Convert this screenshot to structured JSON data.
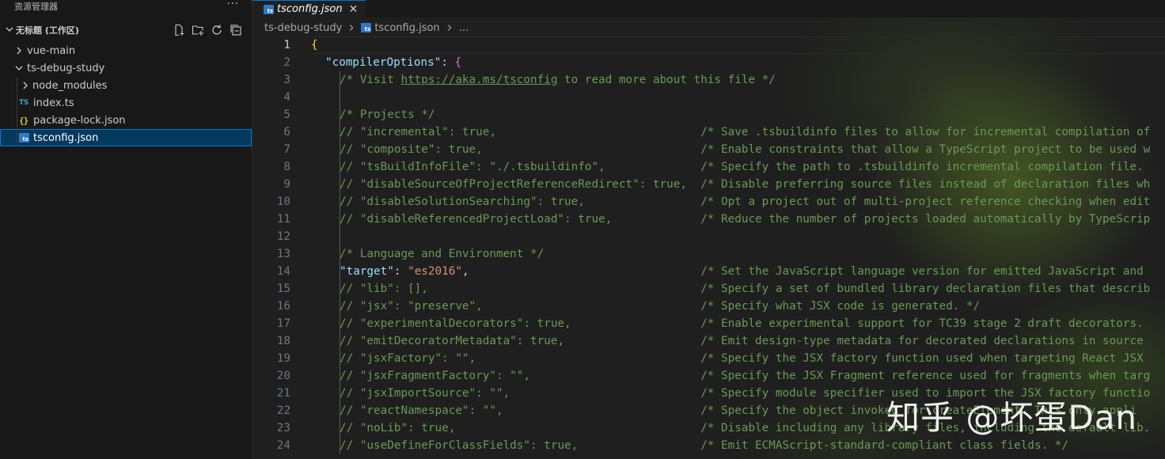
{
  "sidebar": {
    "title": "资源管理器",
    "more": "···",
    "workspace": "无标题 (工作区)",
    "items": [
      {
        "label": "vue-main"
      },
      {
        "label": "ts-debug-study"
      },
      {
        "label": "node_modules"
      },
      {
        "label": "index.ts",
        "badge": "TS"
      },
      {
        "label": "package-lock.json",
        "badge": "{}"
      },
      {
        "label": "tsconfig.json",
        "badge": "ts"
      }
    ]
  },
  "tab": {
    "label": "tsconfig.json",
    "close": "✕",
    "badge": "ts"
  },
  "breadcrumb": {
    "folder": "ts-debug-study",
    "file": "tsconfig.json",
    "rest": "..."
  },
  "code": {
    "ln": [
      "1",
      "2",
      "3",
      "4",
      "5",
      "6",
      "7",
      "8",
      "9",
      "10",
      "11",
      "12",
      "13",
      "14",
      "15",
      "16",
      "17",
      "18",
      "19",
      "20",
      "21",
      "22",
      "23",
      "24"
    ],
    "l1": "{",
    "l2_key": "\"compilerOptions\"",
    "l2_punct": ": ",
    "l2_brace": "{",
    "l3_a": "/* Visit ",
    "l3_link": "https://aka.ms/tsconfig",
    "l3_b": " to read more about this file */",
    "l5": "/* Projects */",
    "l6": "// \"incremental\": true,                              /* Save .tsbuildinfo files to allow for incremental compilation of",
    "l7": "// \"composite\": true,                                /* Enable constraints that allow a TypeScript project to be used w",
    "l8": "// \"tsBuildInfoFile\": \"./.tsbuildinfo\",              /* Specify the path to .tsbuildinfo incremental compilation file.",
    "l9": "// \"disableSourceOfProjectReferenceRedirect\": true,  /* Disable preferring source files instead of declaration files wh",
    "l10": "// \"disableSolutionSearching\": true,                 /* Opt a project out of multi-project reference checking when edit",
    "l11": "// \"disableReferencedProjectLoad\": true,             /* Reduce the number of projects loaded automatically by TypeScrip",
    "l13": "/* Language and Environment */",
    "l14_key": "\"target\"",
    "l14_punct": ": ",
    "l14_val": "\"es2016\"",
    "l14_comma": ",",
    "l14_com": "                                  /* Set the JavaScript language version for emitted JavaScript and",
    "l15": "// \"lib\": [],                                        /* Specify a set of bundled library declaration files that describ",
    "l16": "// \"jsx\": \"preserve\",                                /* Specify what JSX code is generated. */",
    "l17": "// \"experimentalDecorators\": true,                   /* Enable experimental support for TC39 stage 2 draft decorators.",
    "l18": "// \"emitDecoratorMetadata\": true,                    /* Emit design-type metadata for decorated declarations in source",
    "l19": "// \"jsxFactory\": \"\",                                 /* Specify the JSX factory function used when targeting React JSX",
    "l20": "// \"jsxFragmentFactory\": \"\",                         /* Specify the JSX Fragment reference used for fragments when targ",
    "l21": "// \"jsxImportSource\": \"\",                            /* Specify module specifier used to import the JSX factory functio",
    "l22": "// \"reactNamespace\": \"\",                             /* Specify the object invoked for createElement. This only appli",
    "l23": "// \"noLib\": true,                                    /* Disable including any library files, including the default lib.",
    "l24": "// \"useDefineForClassFields\": true,                  /* Emit ECMAScript-standard-compliant class fields. */"
  },
  "watermark": "知乎 @坏蛋Dan",
  "colors": {
    "accent": "#0078d4",
    "comment": "#6a9955",
    "key": "#9cdcfe",
    "string": "#ce9178",
    "brace": "#ffd700"
  }
}
